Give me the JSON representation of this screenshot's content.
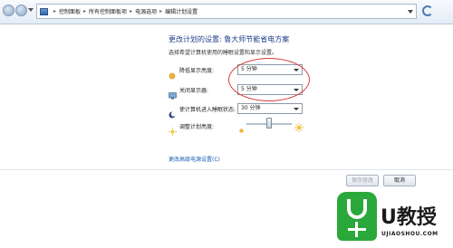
{
  "breadcrumb": {
    "items": [
      "控制面板",
      "所有控制面板项",
      "电源选项",
      "编辑计划设置"
    ],
    "separator": "▸"
  },
  "main": {
    "title": "更改计划的设置: 鲁大师节能省电方案",
    "subtitle": "选择希望计算机使用的睡眠设置和显示设置。",
    "rows": [
      {
        "label": "降低显示亮度:",
        "value": "5 分钟"
      },
      {
        "label": "关闭显示器:",
        "value": "5 分钟"
      },
      {
        "label": "使计算机进入睡眠状态:",
        "value": "30 分钟"
      },
      {
        "label": "调整计划亮度:"
      }
    ],
    "brightness_level": 0.5,
    "advanced_link": "更改高级电源设置(C)"
  },
  "buttons": {
    "save": "保存修改",
    "cancel": "取消"
  },
  "watermark": {
    "brand": "U教授",
    "url": "UJIAOSHOU.COM"
  },
  "colors": {
    "title_blue": "#1e3f8a",
    "link_blue": "#1a5fb4",
    "highlight_red": "#d63a3a",
    "brand_green": "#2aa83a"
  }
}
